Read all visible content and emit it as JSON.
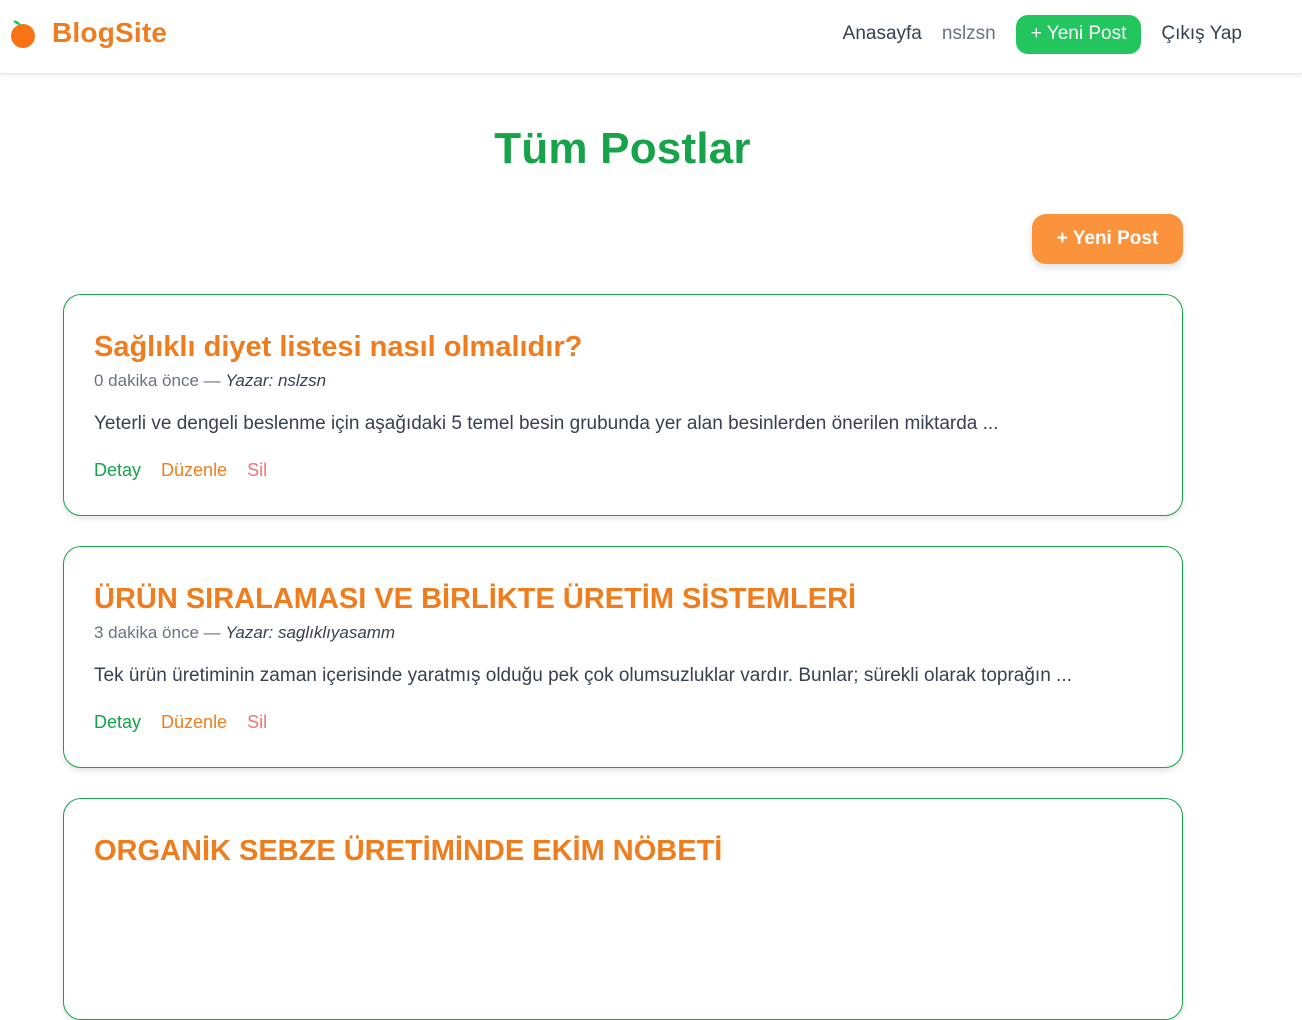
{
  "navbar": {
    "brand": "BlogSite",
    "brand_icon": "orange-fruit-icon",
    "home_label": "Anasayfa",
    "username": "nslzsn",
    "new_post_label": "+ Yeni Post",
    "logout_label": "Çıkış Yap"
  },
  "main": {
    "title": "Tüm Postlar",
    "new_post_label": "+ Yeni Post"
  },
  "posts": [
    {
      "title": "Sağlıklı diyet listesi nasıl olmalıdır?",
      "time": "0 dakika önce",
      "separator": " — ",
      "author": "Yazar: nslzsn",
      "excerpt": "Yeterli ve dengeli beslenme için aşağıdaki 5 temel besin grubunda yer alan besinlerden önerilen miktarda ...",
      "detail_label": "Detay",
      "edit_label": "Düzenle",
      "delete_label": "Sil"
    },
    {
      "title": "ÜRÜN SIRALAMASI VE BİRLİKTE ÜRETİM SİSTEMLERİ",
      "time": "3 dakika önce",
      "separator": " — ",
      "author": "Yazar: saglıklıyasamm",
      "excerpt": "Tek ürün üretiminin zaman içerisinde yaratmış olduğu pek çok olumsuzluklar vardır. Bunlar; sürekli olarak toprağın ...",
      "detail_label": "Detay",
      "edit_label": "Düzenle",
      "delete_label": "Sil"
    },
    {
      "title": "ORGANİK SEBZE ÜRETİMİNDE EKİM NÖBETİ"
    }
  ],
  "colors": {
    "brand_orange": "#f07d1d",
    "accent_green": "#16a34a",
    "button_green": "#22c55e",
    "button_orange": "#fb923c",
    "delete_red": "#f87171"
  }
}
